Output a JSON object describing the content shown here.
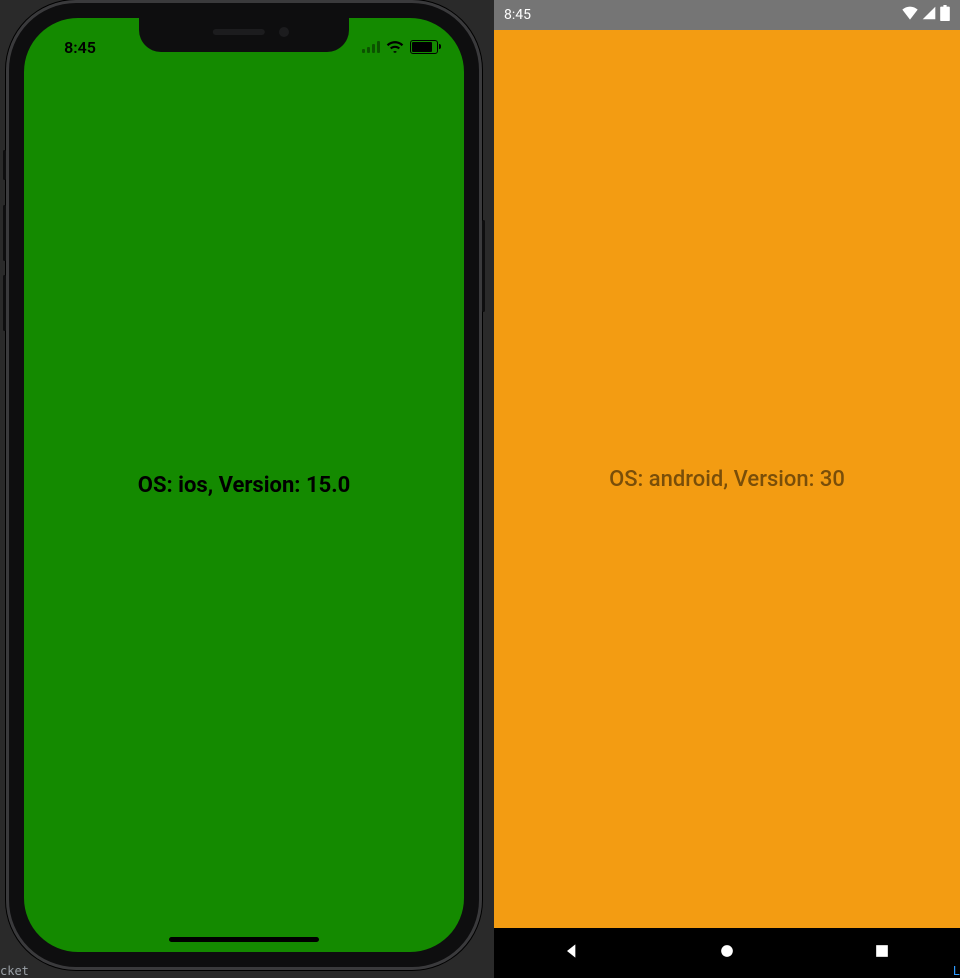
{
  "ios": {
    "status_time": "8:45",
    "content_label": "OS: ios, Version: 15.0"
  },
  "android": {
    "status_time": "8:45",
    "content_label": "OS: android, Version: 30"
  },
  "ide": {
    "bottom_left_fragment": "cket",
    "bottom_right_fragment": "L"
  }
}
